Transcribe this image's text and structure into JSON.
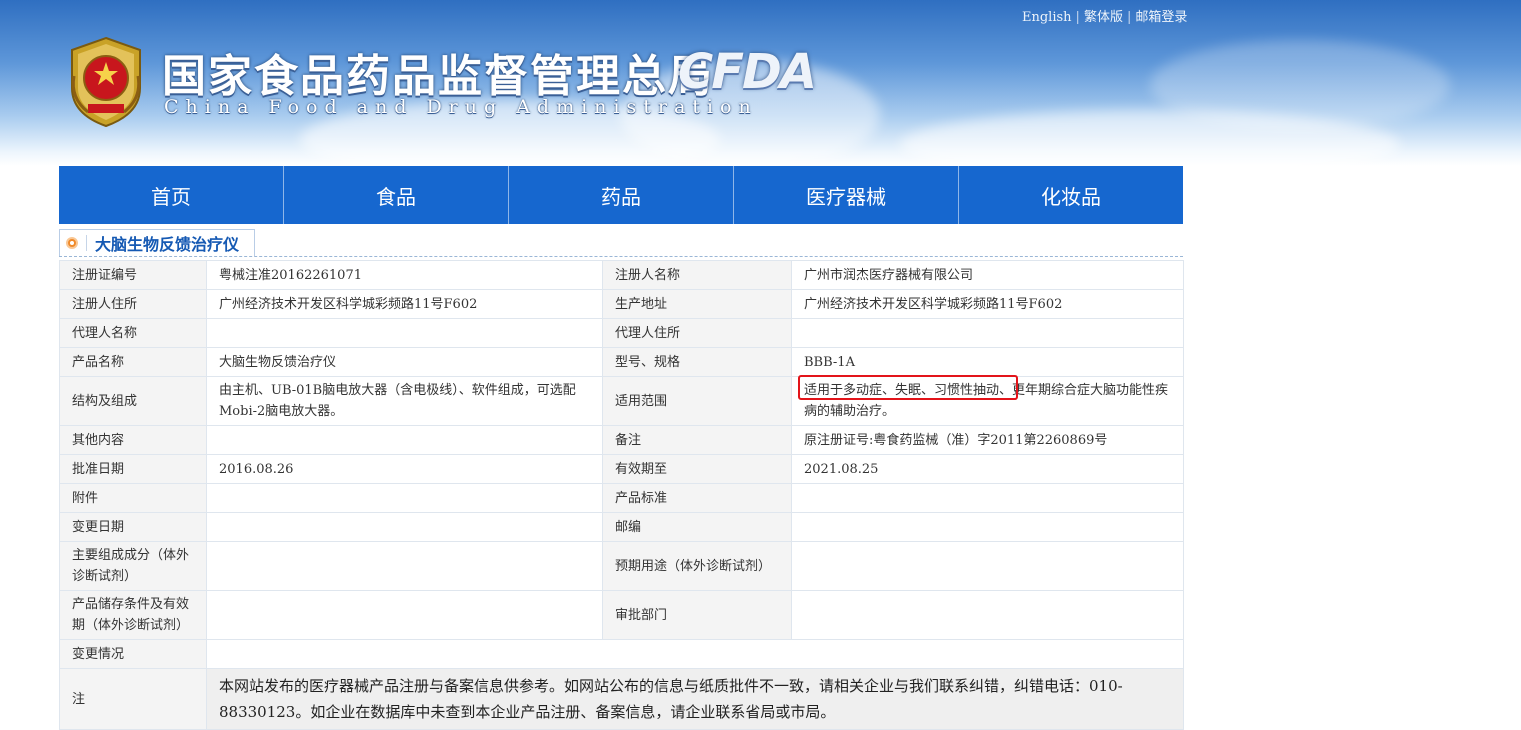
{
  "top_links": [
    "English",
    "繁体版",
    "邮箱登录"
  ],
  "top_sep": "|",
  "logo": {
    "title_cn": "国家食品药品监督管理总局",
    "title_en": "China Food and Drug Administration",
    "abbr": "CFDA"
  },
  "nav": [
    "首页",
    "食品",
    "药品",
    "医疗器械",
    "化妆品"
  ],
  "section_title": "大脑生物反馈治疗仪",
  "rows": [
    {
      "l1": "注册证编号",
      "v1": "粤械注准20162261071",
      "l2": "注册人名称",
      "v2": "广州市润杰医疗器械有限公司"
    },
    {
      "l1": "注册人住所",
      "v1": "广州经济技术开发区科学城彩频路11号F602",
      "l2": "生产地址",
      "v2": "广州经济技术开发区科学城彩频路11号F602"
    },
    {
      "l1": "代理人名称",
      "v1": "",
      "l2": "代理人住所",
      "v2": ""
    },
    {
      "l1": "产品名称",
      "v1": "大脑生物反馈治疗仪",
      "l2": "型号、规格",
      "v2": "BBB-1A"
    },
    {
      "l1": "结构及组成",
      "v1": "由主机、UB-01B脑电放大器（含电极线）、软件组成，可选配Mobi-2脑电放大器。",
      "l2": "适用范围",
      "v2": "适用于多动症、失眠、习惯性抽动、更年期综合症大脑功能性疾病的辅助治疗。"
    },
    {
      "l1": "其他内容",
      "v1": "",
      "l2": "备注",
      "v2": "原注册证号:粤食药监械（准）字2011第2260869号"
    },
    {
      "l1": "批准日期",
      "v1": "2016.08.26",
      "l2": "有效期至",
      "v2": "2021.08.25"
    },
    {
      "l1": "附件",
      "v1": "",
      "l2": "产品标准",
      "v2": ""
    },
    {
      "l1": "变更日期",
      "v1": "",
      "l2": "邮编",
      "v2": ""
    },
    {
      "l1": "主要组成成分（体外诊断试剂）",
      "v1": "",
      "l2": "预期用途（体外诊断试剂）",
      "v2": ""
    },
    {
      "l1": "产品储存条件及有效期（体外诊断试剂）",
      "v1": "",
      "l2": "审批部门",
      "v2": ""
    },
    {
      "l1": "变更情况",
      "v1": ""
    }
  ],
  "note": {
    "label": "注",
    "text": "本网站发布的医疗器械产品注册与备案信息供参考。如网站公布的信息与纸质批件不一致，请相关企业与我们联系纠错，纠错电话：010-88330123。如企业在数据库中未查到本企业产品注册、备案信息，请企业联系省局或市局。"
  },
  "colors": {
    "nav_bg": "#1667cf",
    "highlight_box": "#e3141a",
    "section_title": "#1559b3"
  }
}
